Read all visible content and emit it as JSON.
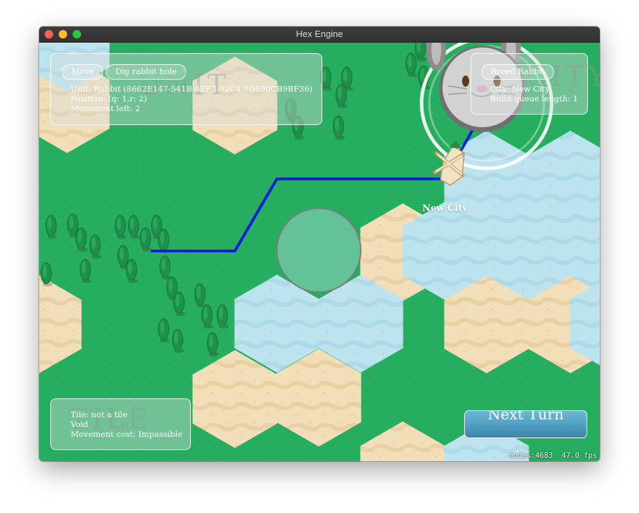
{
  "window": {
    "title": "Hex Engine"
  },
  "unit_panel": {
    "watermark": "UNIT",
    "move_label": "Move",
    "dig_label": "Dig rabbit hole",
    "unit_line": "Unit: Rabbit (8662E147-541B-4EF3-92C4-9D590CB9BF36)",
    "position_line": "Position: (q: 1,r: 2)",
    "movement_line": "Movement left: 2"
  },
  "city_panel": {
    "watermark": "CITY",
    "breed_label": "Breed Rabbit",
    "city_line": "City: New City",
    "queue_line": "Build queue length: 1"
  },
  "tile_panel": {
    "watermark": "TILE",
    "tile_line": "Tile: not a tile",
    "type_line": "Void",
    "cost_line": "Movement cost: Impassible"
  },
  "map": {
    "city_name": "New City"
  },
  "next_turn_label": "Next Turn",
  "stats": {
    "nodes": "nodes:4683",
    "fps": "47.0 fps"
  },
  "colors": {
    "grass": "#27ad5f",
    "sand": "#f2dfb9",
    "water": "#bde3ee",
    "path": "#0a1ed8",
    "tree": "#1f8f4c"
  },
  "icons": [
    "rabbit-unit-icon",
    "windmill-city-icon",
    "tree-icon"
  ]
}
